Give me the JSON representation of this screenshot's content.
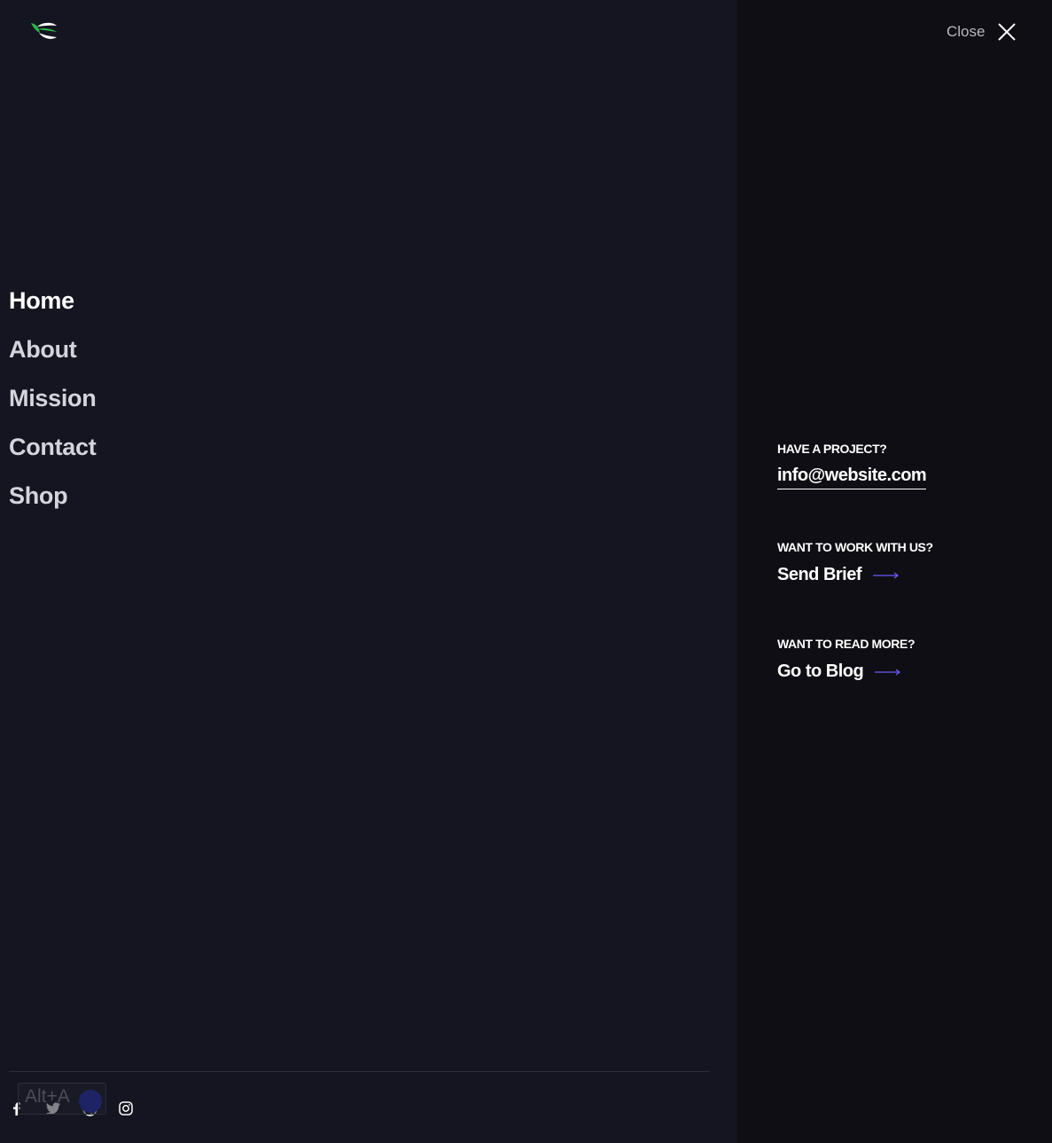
{
  "header": {
    "logo_icon": "leaf-logo-icon",
    "close_label": "Close",
    "close_icon": "close-x-icon"
  },
  "nav": {
    "items": [
      {
        "label": "Home",
        "active": true
      },
      {
        "label": "About"
      },
      {
        "label": "Mission"
      },
      {
        "label": "Contact"
      },
      {
        "label": "Shop"
      }
    ]
  },
  "contact": {
    "project_label": "HAVE A PROJECT?",
    "email": "info@website.com",
    "work_label": "WANT TO WORK WITH US?",
    "brief_link": "Send Brief",
    "read_label": "WANT TO READ MORE?",
    "blog_link": "Go to Blog"
  },
  "social": {
    "icons": [
      "facebook-icon",
      "twitter-icon",
      "dribbble-icon",
      "instagram-icon"
    ]
  },
  "overlay": {
    "shortcut_text": "Alt+A"
  },
  "colors": {
    "left_background": "#141520",
    "right_background": "#0e0e14",
    "accent_arrow": "#6b5cf6",
    "logo_green": "#2cb34a"
  }
}
